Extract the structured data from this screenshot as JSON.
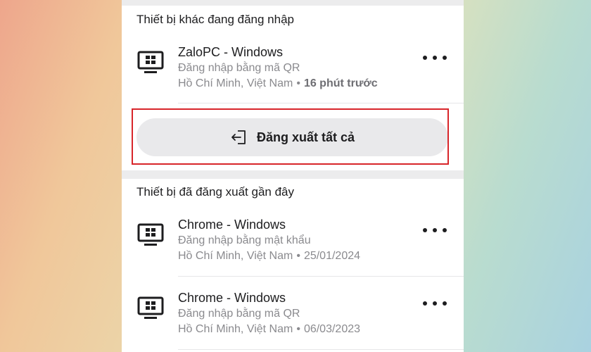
{
  "section_active": {
    "title": "Thiết bị khác đang đăng nhập"
  },
  "active_devices": [
    {
      "name": "ZaloPC - Windows",
      "method": "Đăng nhập bằng mã QR",
      "location": "Hồ Chí Minh, Việt Nam",
      "separator": "•",
      "time": "16 phút trước",
      "icon": "windows-monitor-icon"
    }
  ],
  "logout_all": {
    "label": "Đăng xuất tất cả",
    "icon": "logout-icon"
  },
  "section_logged_out": {
    "title": "Thiết bị đã đăng xuất gần đây"
  },
  "logged_out_devices": [
    {
      "name": "Chrome - Windows",
      "method": "Đăng nhập bằng mật khẩu",
      "location": "Hồ Chí Minh, Việt Nam",
      "separator": "•",
      "time": "25/01/2024",
      "icon": "windows-monitor-icon"
    },
    {
      "name": "Chrome - Windows",
      "method": "Đăng nhập bằng mã QR",
      "location": "Hồ Chí Minh, Việt Nam",
      "separator": "•",
      "time": "06/03/2023",
      "icon": "windows-monitor-icon"
    }
  ],
  "colors": {
    "highlight": "#d8252a",
    "button_bg": "#e9e9eb",
    "secondary_text": "#8a8a8e"
  }
}
